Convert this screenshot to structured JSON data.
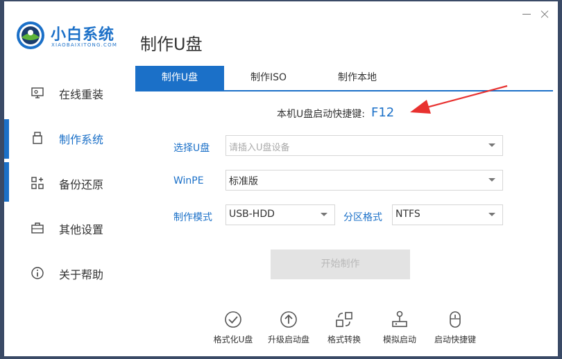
{
  "app": {
    "logo_title": "小白系统",
    "logo_subtitle": "XIAOBAIXITONG.COM",
    "page_title": "制作U盘"
  },
  "sidebar": {
    "items": [
      {
        "label": "在线重装",
        "icon": "monitor-icon"
      },
      {
        "label": "制作系统",
        "icon": "usb-drive-icon",
        "active": true
      },
      {
        "label": "备份还原",
        "icon": "backup-grid-icon"
      },
      {
        "label": "其他设置",
        "icon": "toolbox-icon"
      },
      {
        "label": "关于帮助",
        "icon": "info-icon"
      }
    ]
  },
  "tabs": [
    {
      "label": "制作U盘",
      "active": true
    },
    {
      "label": "制作ISO"
    },
    {
      "label": "制作本地"
    }
  ],
  "hotkey": {
    "label": "本机U盘启动快捷键:",
    "value": "F12"
  },
  "form": {
    "usb_label": "选择U盘",
    "usb_placeholder": "请插入U盘设备",
    "winpe_label": "WinPE",
    "winpe_value": "标准版",
    "mode_label": "制作模式",
    "mode_value": "USB-HDD",
    "partition_label": "分区格式",
    "partition_value": "NTFS"
  },
  "start_button": "开始制作",
  "tools": [
    {
      "label": "格式化U盘",
      "icon": "check-circle-icon"
    },
    {
      "label": "升级启动盘",
      "icon": "upgrade-arrow-icon"
    },
    {
      "label": "格式转换",
      "icon": "convert-arrows-icon"
    },
    {
      "label": "模拟启动",
      "icon": "joystick-icon"
    },
    {
      "label": "启动快捷键",
      "icon": "mouse-icon"
    }
  ],
  "colors": {
    "accent": "#1b70c8",
    "annotation_arrow": "#e8312f",
    "disabled_button": "#e3e3e3"
  }
}
